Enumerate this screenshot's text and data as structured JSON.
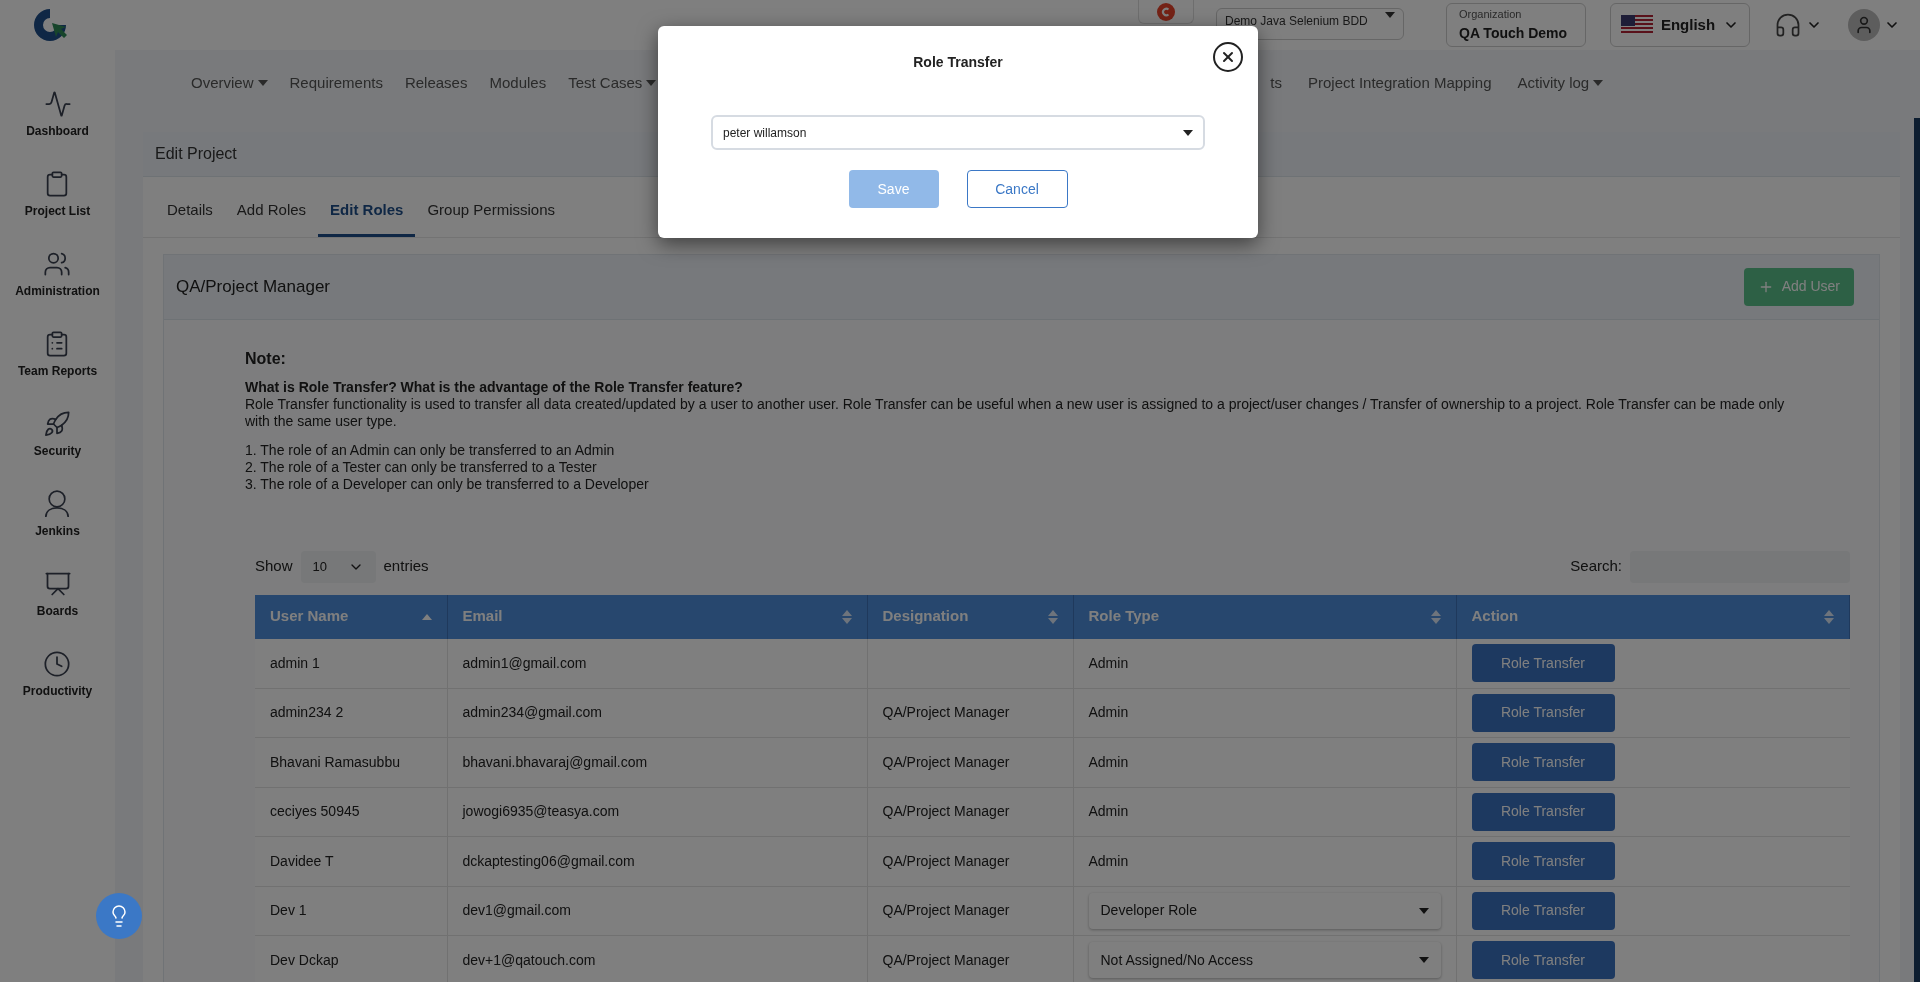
{
  "top_bar": {
    "project_select": "Demo Java Selenium BDD",
    "organization": {
      "label": "Organization",
      "value": "QA Touch Demo"
    },
    "language": "English"
  },
  "sidebar": {
    "items": [
      {
        "label": "Dashboard"
      },
      {
        "label": "Project List"
      },
      {
        "label": "Administration"
      },
      {
        "label": "Team Reports"
      },
      {
        "label": "Security"
      },
      {
        "label": "Jenkins"
      },
      {
        "label": "Boards"
      },
      {
        "label": "Productivity"
      }
    ]
  },
  "nav": {
    "left": [
      {
        "label": "Overview",
        "dropdown": true
      },
      {
        "label": "Requirements",
        "dropdown": false
      },
      {
        "label": "Releases",
        "dropdown": false
      },
      {
        "label": "Modules",
        "dropdown": false
      },
      {
        "label": "Test Cases",
        "dropdown": true
      }
    ],
    "right": [
      {
        "label": "ts",
        "dropdown": false
      },
      {
        "label": "Project Integration Mapping",
        "dropdown": false
      },
      {
        "label": "Activity log",
        "dropdown": true
      }
    ]
  },
  "edit_project": {
    "title": "Edit Project",
    "tabs": [
      {
        "label": "Details",
        "selected": false
      },
      {
        "label": "Add Roles",
        "selected": false
      },
      {
        "label": "Edit Roles",
        "selected": true
      },
      {
        "label": "Group Permissions",
        "selected": false
      }
    ],
    "panel": {
      "title": "QA/Project Manager",
      "add_user": "Add User",
      "note": {
        "title": "Note:",
        "question": "What is Role Transfer? What is the advantage of the Role Transfer feature?",
        "text": "Role Transfer functionality is used to transfer all data created/updated by a user to another user. Role Transfer can be useful when a new user is assigned to a project/user changes / Transfer of ownership to a project. Role Transfer can be made only with the same user type.",
        "rules": [
          "1. The role of an Admin can only be transferred to an Admin",
          "2. The role of a Tester can only be transferred to a Tester",
          "3. The role of a Developer can only be transferred to a Developer"
        ]
      },
      "show": "Show",
      "entries_value": "10",
      "entries": "entries",
      "search_label": "Search:",
      "table": {
        "columns": [
          {
            "label": "User Name",
            "sorted": true
          },
          {
            "label": "Email",
            "sorted": false
          },
          {
            "label": "Designation",
            "sorted": false
          },
          {
            "label": "Role Type",
            "sorted": false
          },
          {
            "label": "Action",
            "sorted": false
          }
        ],
        "rows": [
          {
            "user": "admin 1",
            "email": "admin1@gmail.com",
            "designation": "",
            "role": {
              "kind": "text",
              "value": "Admin"
            },
            "action": "Role Transfer"
          },
          {
            "user": "admin234 2",
            "email": "admin234@gmail.com",
            "designation": "QA/Project Manager",
            "role": {
              "kind": "text",
              "value": "Admin"
            },
            "action": "Role Transfer"
          },
          {
            "user": "Bhavani Ramasubbu",
            "email": "bhavani.bhavaraj@gmail.com",
            "designation": "QA/Project Manager",
            "role": {
              "kind": "text",
              "value": "Admin"
            },
            "action": "Role Transfer"
          },
          {
            "user": "ceciyes 50945",
            "email": "jowogi6935@teasya.com",
            "designation": "QA/Project Manager",
            "role": {
              "kind": "text",
              "value": "Admin"
            },
            "action": "Role Transfer"
          },
          {
            "user": "Davidee T",
            "email": "dckaptesting06@gmail.com",
            "designation": "QA/Project Manager",
            "role": {
              "kind": "text",
              "value": "Admin"
            },
            "action": "Role Transfer"
          },
          {
            "user": "Dev 1",
            "email": "dev1@gmail.com",
            "designation": "QA/Project Manager",
            "role": {
              "kind": "select",
              "value": "Developer Role"
            },
            "action": "Role Transfer"
          },
          {
            "user": "Dev Dckap",
            "email": "dev+1@qatouch.com",
            "designation": "QA/Project Manager",
            "role": {
              "kind": "select",
              "value": "Not Assigned/No Access"
            },
            "action": "Role Transfer"
          }
        ]
      }
    }
  },
  "modal": {
    "title": "Role Transfer",
    "select_value": "peter willamson",
    "save": {
      "label": "Save",
      "disabled": true
    },
    "cancel": "Cancel"
  }
}
